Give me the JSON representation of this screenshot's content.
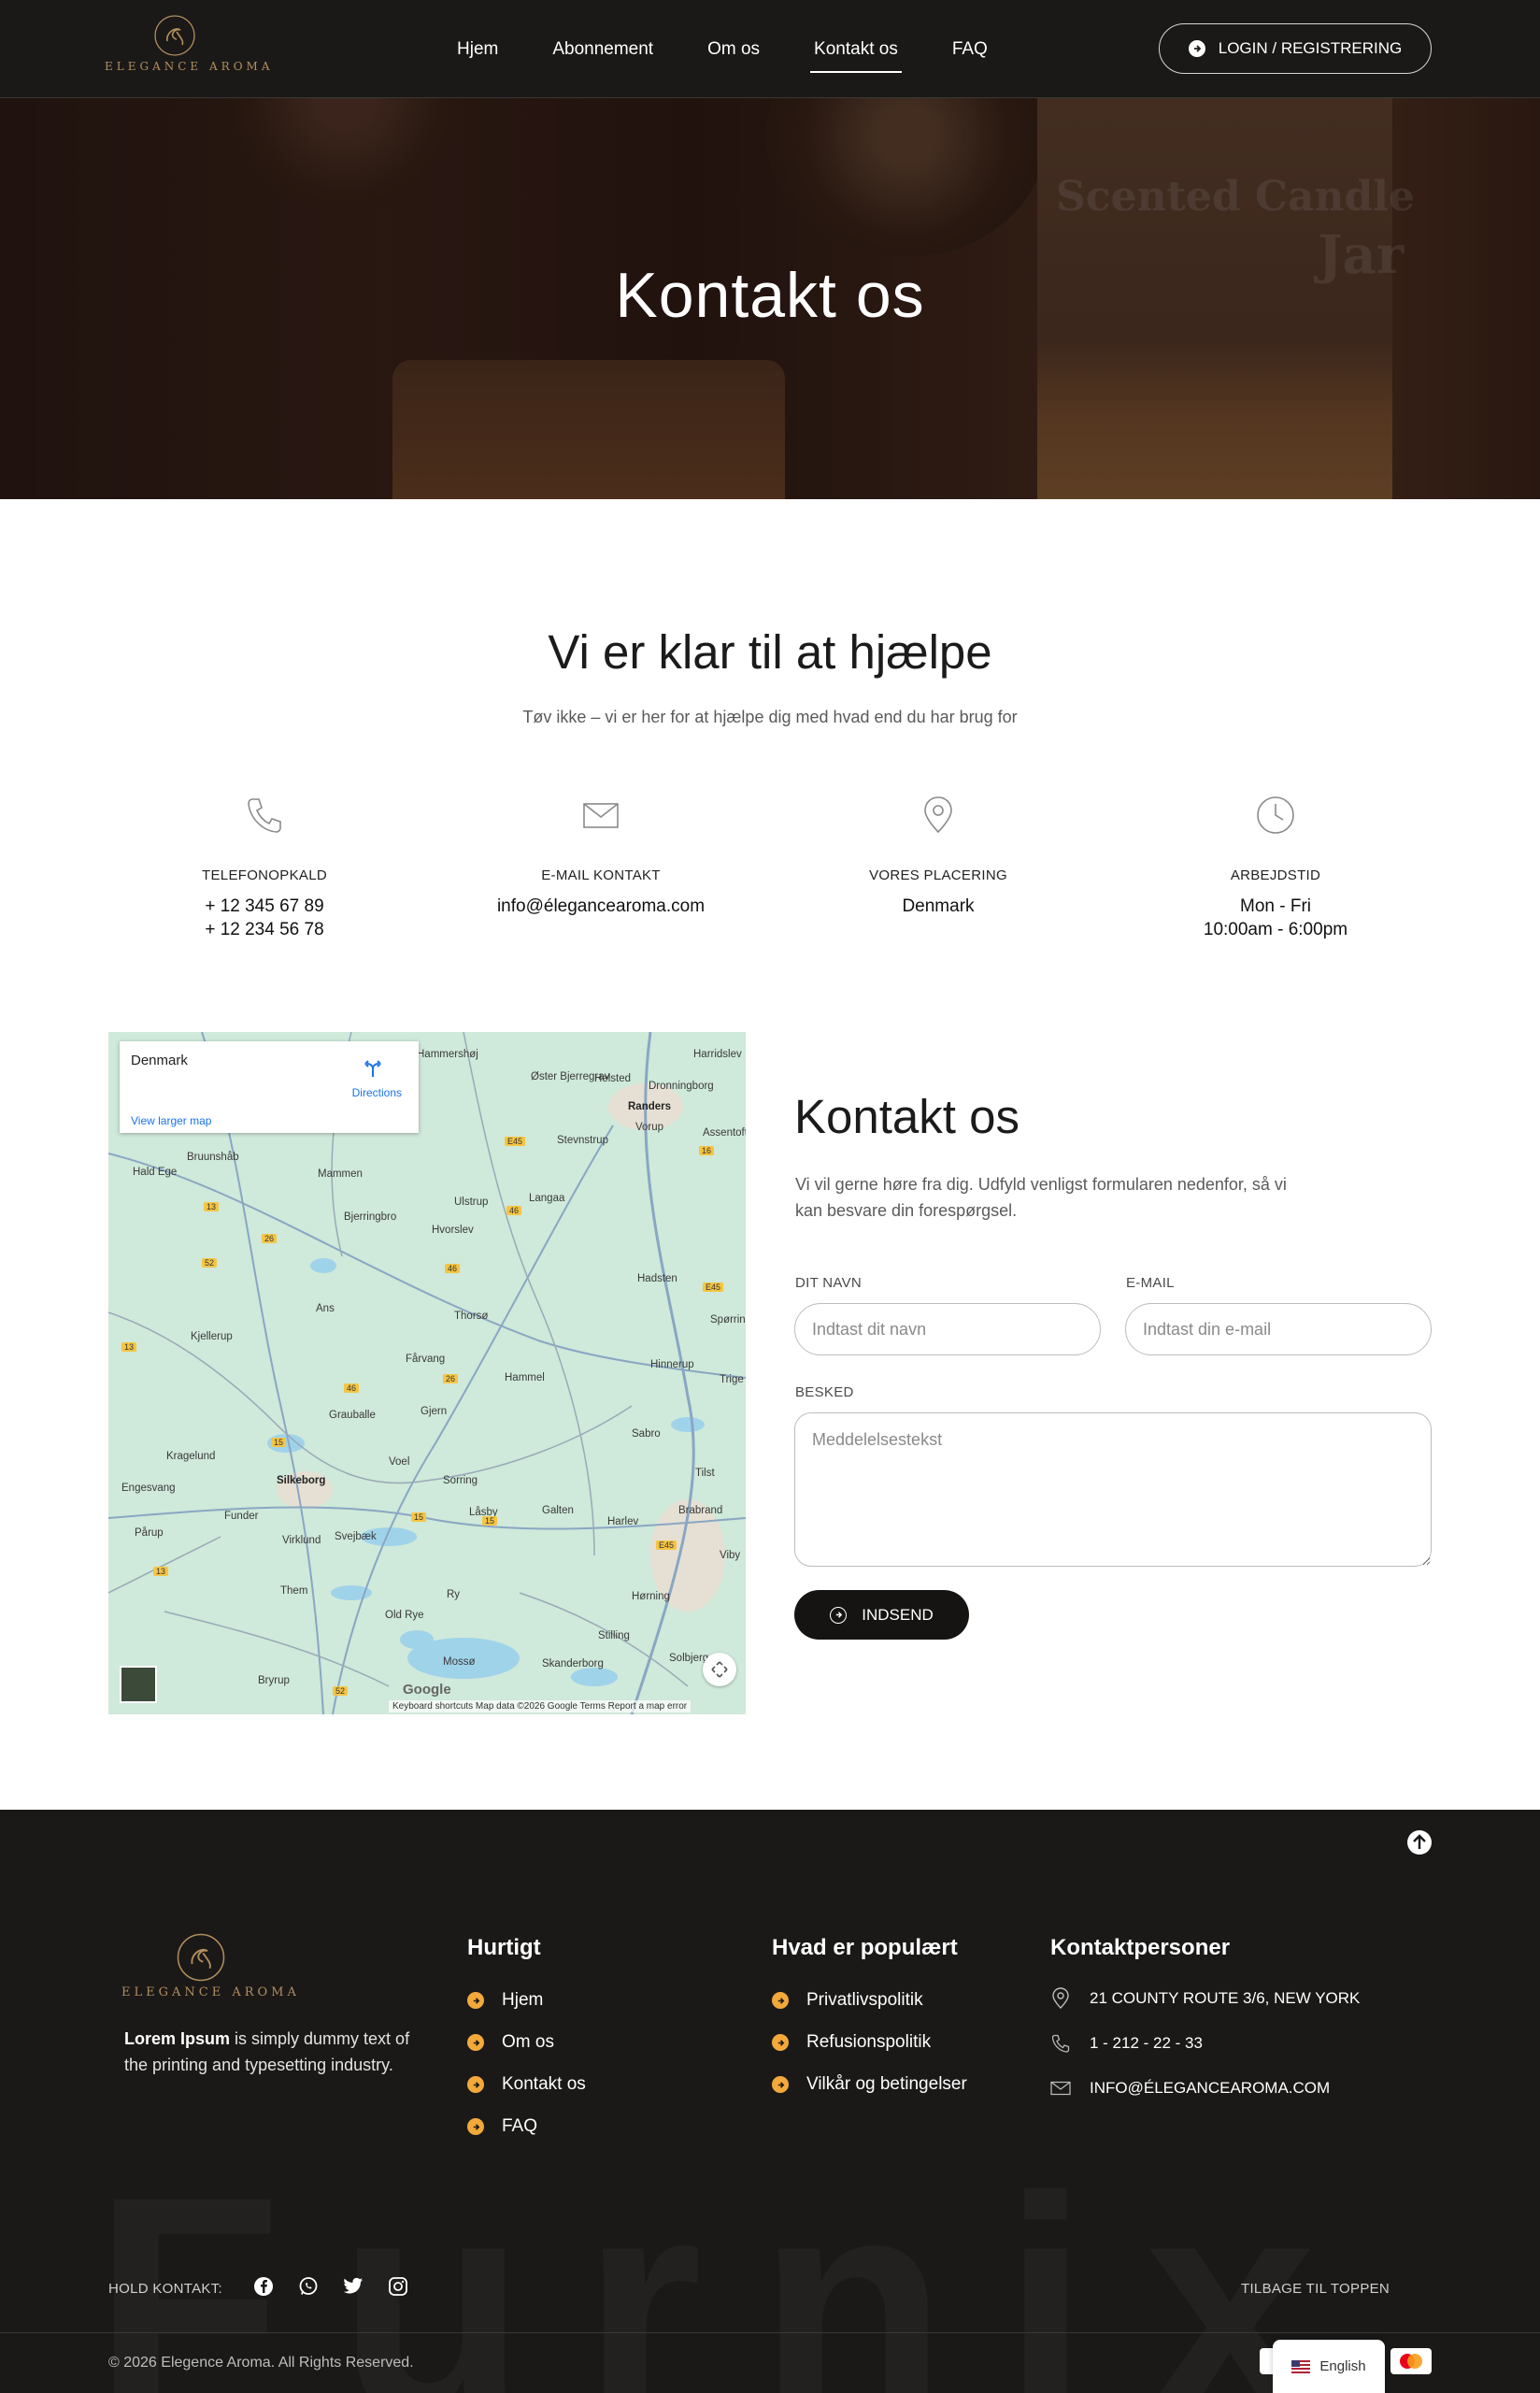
{
  "header": {
    "logo_text": "ELEGANCE AROMA",
    "nav": [
      "Hjem",
      "Abonnement",
      "Om os",
      "Kontakt os",
      "FAQ"
    ],
    "active_nav": "Kontakt os",
    "login_label": "LOGIN / REGISTRERING"
  },
  "hero": {
    "title": "Kontakt os",
    "background_text_1": "Scented Candle",
    "background_text_2": "Jar"
  },
  "help": {
    "title": "Vi er klar til at hjælpe",
    "subtitle": "Tøv ikke – vi er her for at hjælpe dig med hvad end du har brug for",
    "items": [
      {
        "icon": "phone-icon",
        "label": "TELEFONOPKALD",
        "line1": "+ 12 345 67 89",
        "line2": "+ 12 234 56 78"
      },
      {
        "icon": "envelope-icon",
        "label": "E-MAIL KONTAKT",
        "line1": "info@éleganceаroma.com",
        "line2": ""
      },
      {
        "icon": "map-pin-icon",
        "label": "VORES PLACERING",
        "line1": "Denmark",
        "line2": ""
      },
      {
        "icon": "clock-icon",
        "label": "ARBEJDSTID",
        "line1": "Mon - Fri",
        "line2": "10:00am - 6:00pm"
      }
    ]
  },
  "map": {
    "place": "Denmark",
    "directions": "Directions",
    "larger_map": "View larger map",
    "footer": "Keyboard shortcuts    Map data ©2026 Google    Terms    Report a map error",
    "google": "Google",
    "towns": [
      "Randers",
      "Silkeborg",
      "Bjerringbro",
      "Mammen",
      "Ulstrup",
      "Langaa",
      "Hvorslev",
      "Thorsø",
      "Hammel",
      "Hadsten",
      "Hinnerup",
      "Fårvang",
      "Gjern",
      "Grauballe",
      "Kjellerup",
      "Kragelund",
      "Engesvang",
      "Funder",
      "Virklund",
      "Svejbæk",
      "Voel",
      "Sorring",
      "Låsby",
      "Galten",
      "Harlev",
      "Sabro",
      "Tilst",
      "Brabrand",
      "Them",
      "Ry",
      "Old Rye",
      "Hørning",
      "Stilling",
      "Skanderborg",
      "Mossø",
      "Bryrup",
      "Stevnstrup",
      "Vorup",
      "Dronningborg",
      "Bruunshåb",
      "Hald Ege",
      "Ans",
      "Assentoft",
      "Spørring",
      "Solbjerg",
      "Helsted",
      "Øster Bjerregrav",
      "Hammershøj",
      "Harridslev",
      "Trige",
      "Viby",
      "Pårup"
    ]
  },
  "form": {
    "title": "Kontakt os",
    "description": "Vi vil gerne høre fra dig. Udfyld venligst formularen nedenfor, så vi kan besvare din forespørgsel.",
    "name_label": "DIT NAVN",
    "name_placeholder": "Indtast dit navn",
    "email_label": "E-MAIL",
    "email_placeholder": "Indtast din e-mail",
    "message_label": "BESKED",
    "message_placeholder": "Meddelelsestekst",
    "submit_label": "INDSEND"
  },
  "footer": {
    "logo_text": "ELEGANCE AROMA",
    "about_bold": "Lorem Ipsum",
    "about_rest": " is simply dummy text of the printing and typesetting industry.",
    "quick_title": "Hurtigt",
    "quick_links": [
      "Hjem",
      "Om os",
      "Kontakt os",
      "FAQ"
    ],
    "popular_title": "Hvad er populært",
    "popular_links": [
      "Privatlivspolitik",
      "Refusionspolitik",
      "Vilkår og betingelser"
    ],
    "contact_title": "Kontaktpersoner",
    "address": "21 COUNTY ROUTE 3/6,  NEW YORK",
    "phone": "1 - 212 - 22 - 33",
    "email": "INFO@ÉLEGANCEAROMA.COM",
    "hold_contact": "HOLD KONTAKT:",
    "socials": [
      "facebook-icon",
      "whatsapp-icon",
      "twitter-icon",
      "instagram-icon"
    ],
    "back_to_top": "TILBAGE TIL TOPPEN",
    "copyright": "© 2026 Elegence Aroma. All Rights Reserved.",
    "watermark": "Furnix",
    "language": "English"
  },
  "colors": {
    "dark": "#1a1918",
    "gold": "#b38e5d",
    "accent_orange": "#f3a93a",
    "map_green": "#cfe9da"
  }
}
